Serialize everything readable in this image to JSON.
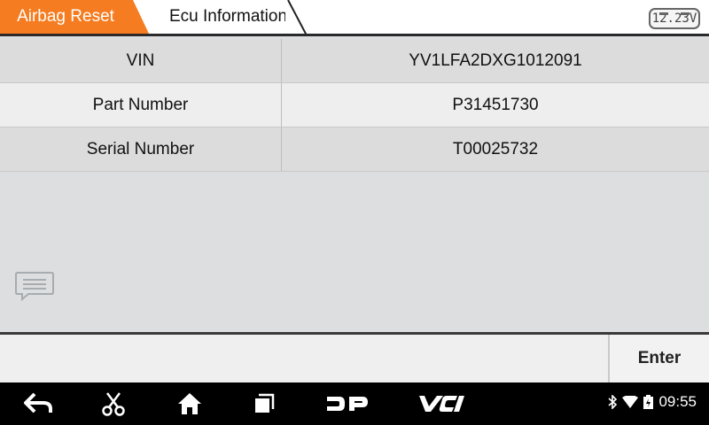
{
  "tabs": [
    {
      "label": "Airbag Reset",
      "active": true
    },
    {
      "label": "Ecu Information",
      "active": false
    }
  ],
  "battery": {
    "voltage": "12.23V"
  },
  "ecu_info": {
    "rows": [
      {
        "key": "VIN",
        "value": "YV1LFA2DXG1012091"
      },
      {
        "key": "Part Number",
        "value": "P31451730"
      },
      {
        "key": "Serial Number",
        "value": "T00025732"
      }
    ]
  },
  "actions": {
    "enter_label": "Enter"
  },
  "navbar": {
    "icons": [
      "back-icon",
      "scissors-icon",
      "home-icon",
      "recent-apps-icon",
      "dp-icon",
      "vci-icon"
    ],
    "time": "09:55"
  },
  "colors": {
    "accent": "#f57c20",
    "nav_bg": "#000000"
  }
}
